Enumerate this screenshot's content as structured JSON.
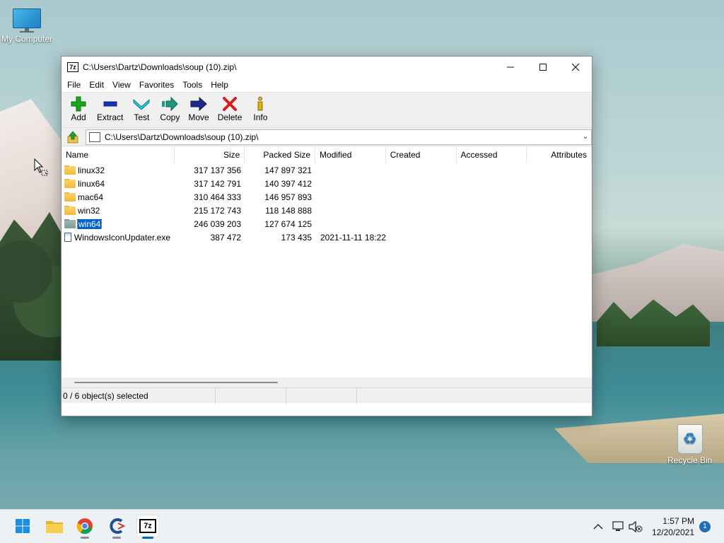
{
  "desktop": {
    "icons": [
      {
        "label": "My Computer"
      },
      {
        "label": "Recycle Bin"
      }
    ]
  },
  "window": {
    "title": "C:\\Users\\Dartz\\Downloads\\soup (10).zip\\",
    "app_icon_text": "7z",
    "controls": {
      "minimize": "—",
      "maximize": "☐",
      "close": "✕"
    },
    "menu": [
      "File",
      "Edit",
      "View",
      "Favorites",
      "Tools",
      "Help"
    ],
    "toolbar": [
      {
        "label": "Add",
        "icon": "plus-icon",
        "color": "#1aa81a"
      },
      {
        "label": "Extract",
        "icon": "minus-icon",
        "color": "#1433b8"
      },
      {
        "label": "Test",
        "icon": "check-chevron-icon",
        "color": "#18a9b8"
      },
      {
        "label": "Copy",
        "icon": "copy-arrow-icon",
        "color": "#1a9a80"
      },
      {
        "label": "Move",
        "icon": "move-arrow-icon",
        "color": "#1a2a8a"
      },
      {
        "label": "Delete",
        "icon": "x-icon",
        "color": "#d01f1f"
      },
      {
        "label": "Info",
        "icon": "info-icon",
        "color": "#c9a500"
      }
    ],
    "address": {
      "path": "C:\\Users\\Dartz\\Downloads\\soup (10).zip\\",
      "dropdown": "⌄"
    },
    "columns": [
      "Name",
      "Size",
      "Packed Size",
      "Modified",
      "Created",
      "Accessed",
      "Attributes"
    ],
    "rows": [
      {
        "name": "linux32",
        "type": "folder",
        "size": "317 137 356",
        "packed": "147 897 321",
        "modified": "",
        "selected": false
      },
      {
        "name": "linux64",
        "type": "folder",
        "size": "317 142 791",
        "packed": "140 397 412",
        "modified": "",
        "selected": false
      },
      {
        "name": "mac64",
        "type": "folder",
        "size": "310 464 333",
        "packed": "146 957 893",
        "modified": "",
        "selected": false
      },
      {
        "name": "win32",
        "type": "folder",
        "size": "215 172 743",
        "packed": "118 148 888",
        "modified": "",
        "selected": false
      },
      {
        "name": "win64",
        "type": "folder",
        "size": "246 039 203",
        "packed": "127 674 125",
        "modified": "",
        "selected": true
      },
      {
        "name": "WindowsIconUpdater.exe",
        "type": "exe",
        "size": "387 472",
        "packed": "173 435",
        "modified": "2021-11-11 18:22",
        "selected": false
      }
    ],
    "status": "0 / 6 object(s) selected"
  },
  "taskbar": {
    "apps": [
      {
        "name": "start",
        "icon": "windows-start-icon"
      },
      {
        "name": "file-explorer",
        "icon": "folder-icon"
      },
      {
        "name": "chrome",
        "icon": "chrome-icon"
      },
      {
        "name": "ccleaner",
        "icon": "ccleaner-icon"
      },
      {
        "name": "7zip",
        "icon": "7zip-icon",
        "text": "7z"
      }
    ],
    "clock": {
      "time": "1:57 PM",
      "date": "12/20/2021"
    },
    "notification_count": "1"
  }
}
